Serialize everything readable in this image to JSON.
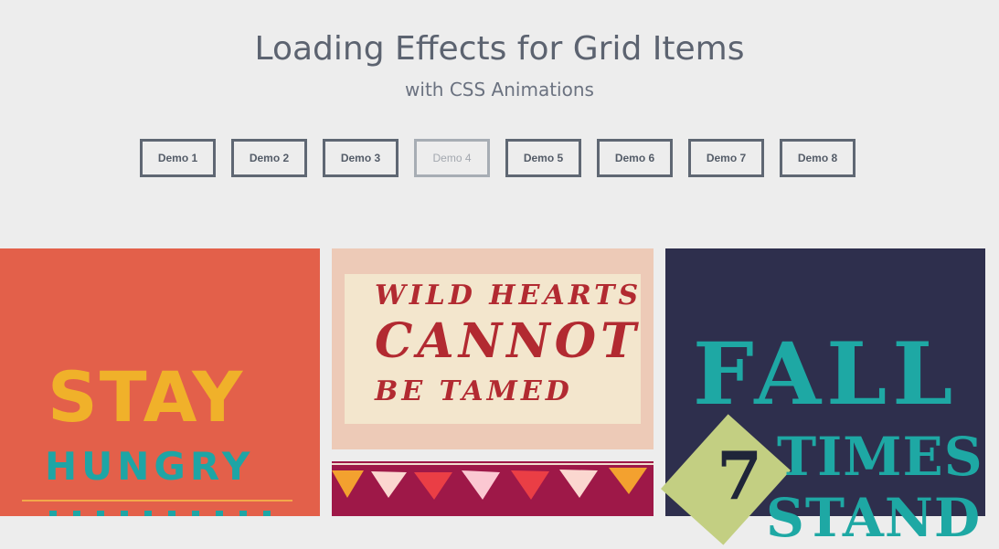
{
  "header": {
    "title": "Loading Effects for Grid Items",
    "subtitle": "with CSS Animations"
  },
  "demos": [
    {
      "label": "Demo 1",
      "active": false
    },
    {
      "label": "Demo 2",
      "active": false
    },
    {
      "label": "Demo 3",
      "active": false
    },
    {
      "label": "Demo 4",
      "active": true
    },
    {
      "label": "Demo 5",
      "active": false
    },
    {
      "label": "Demo 6",
      "active": false
    },
    {
      "label": "Demo 7",
      "active": false
    },
    {
      "label": "Demo 8",
      "active": false
    }
  ],
  "grid": {
    "item_1": {
      "line_1": "STAY",
      "line_2": "HUNGRY",
      "background": "#e3604a"
    },
    "item_2": {
      "line_1": "WILD HEARTS",
      "line_2": "CANNOT",
      "line_3": "BE TAMED",
      "background": "#f3e6cd"
    },
    "item_3": {
      "background": "#9e1848"
    },
    "item_4": {
      "line_1": "FALL",
      "number": "7",
      "line_2": "TIMES",
      "line_3": "STAND",
      "background": "#2e2f4d"
    }
  },
  "colors": {
    "page_background": "#ededed",
    "title_text": "#5c6370",
    "button_border": "#5f6773",
    "active_button_border": "#a7adb4",
    "accent_teal": "#1ea8a4",
    "accent_yellow": "#f0b12a",
    "accent_red": "#b22a31"
  }
}
